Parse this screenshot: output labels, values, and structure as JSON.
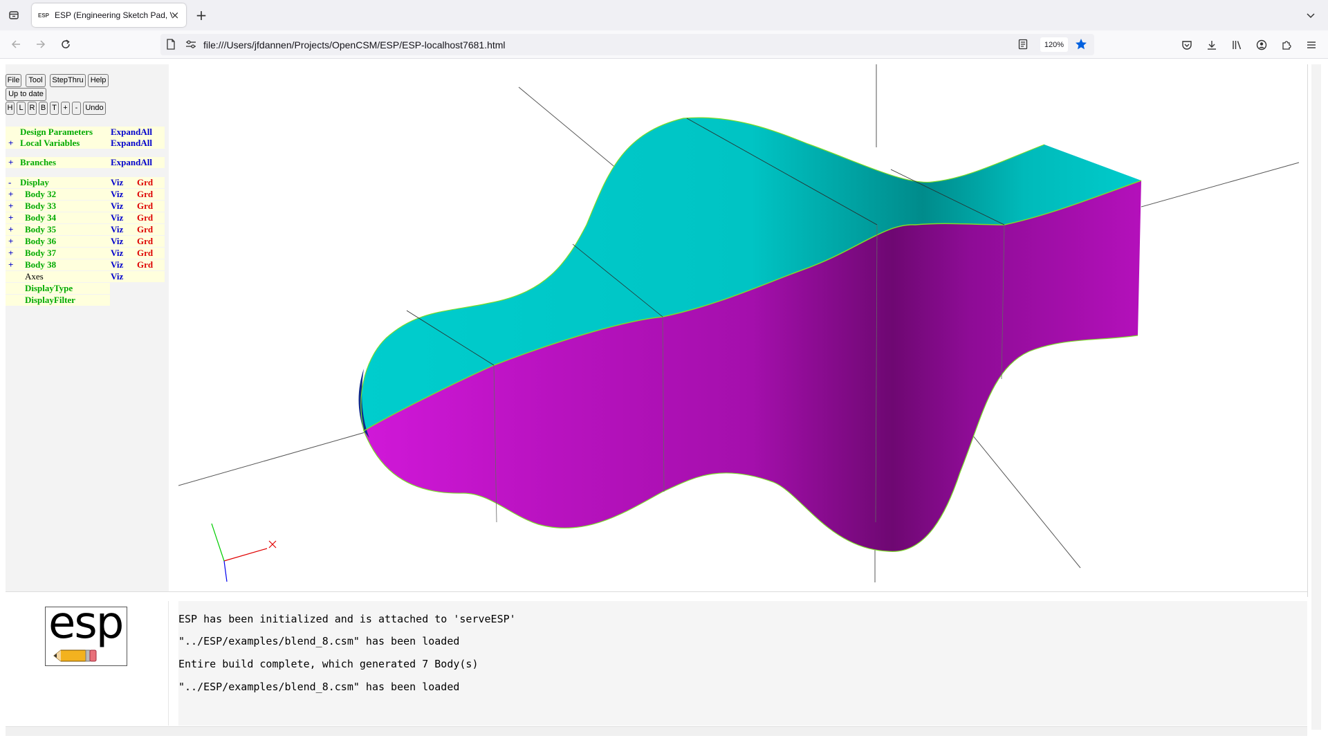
{
  "browser": {
    "tab_title": "ESP (Engineering Sketch Pad, V",
    "tab_favicon_text": "ESP",
    "url": "file:///Users/jfdannen/Projects/OpenCSM/ESP/ESP-localhost7681.html",
    "zoom": "120%",
    "accent_color": "#0060df"
  },
  "toolbar": {
    "row1": [
      "File",
      "Tool",
      "StepThru",
      "Help"
    ],
    "status_button": "Up to date",
    "row3": [
      "H",
      "L",
      "R",
      "B",
      "T",
      "+",
      "-",
      "Undo"
    ]
  },
  "tree": {
    "design_parameters": {
      "pm": "",
      "label": "Design Parameters",
      "action": "ExpandAll"
    },
    "local_variables": {
      "pm": "+",
      "label": "Local Variables",
      "action": "ExpandAll"
    },
    "branches": {
      "pm": "+",
      "label": "Branches",
      "action": "ExpandAll"
    },
    "display": {
      "pm": "-",
      "label": "Display",
      "viz": "Viz",
      "grd": "Grd"
    },
    "bodies": [
      {
        "pm": "+",
        "label": "Body 32",
        "viz": "Viz",
        "grd": "Grd"
      },
      {
        "pm": "+",
        "label": "Body 33",
        "viz": "Viz",
        "grd": "Grd"
      },
      {
        "pm": "+",
        "label": "Body 34",
        "viz": "Viz",
        "grd": "Grd"
      },
      {
        "pm": "+",
        "label": "Body 35",
        "viz": "Viz",
        "grd": "Grd"
      },
      {
        "pm": "+",
        "label": "Body 36",
        "viz": "Viz",
        "grd": "Grd"
      },
      {
        "pm": "+",
        "label": "Body 37",
        "viz": "Viz",
        "grd": "Grd"
      },
      {
        "pm": "+",
        "label": "Body 38",
        "viz": "Viz",
        "grd": "Grd"
      }
    ],
    "axes": {
      "label": "Axes",
      "viz": "Viz"
    },
    "display_type": {
      "label": "DisplayType"
    },
    "display_filter": {
      "label": "DisplayFilter"
    }
  },
  "viewer": {
    "top_color": "#00c8c8",
    "side_color": "#b010b8",
    "axis_x_color": "#e00000",
    "axis_y_color": "#00cc00",
    "axis_z_color": "#0000ee"
  },
  "logo": {
    "text": "esp"
  },
  "messages": [
    "ESP has been initialized and is attached to 'serveESP'",
    "\"../ESP/examples/blend_8.csm\" has been loaded",
    "Entire build complete, which generated 7 Body(s)",
    "\"../ESP/examples/blend_8.csm\" has been loaded"
  ]
}
